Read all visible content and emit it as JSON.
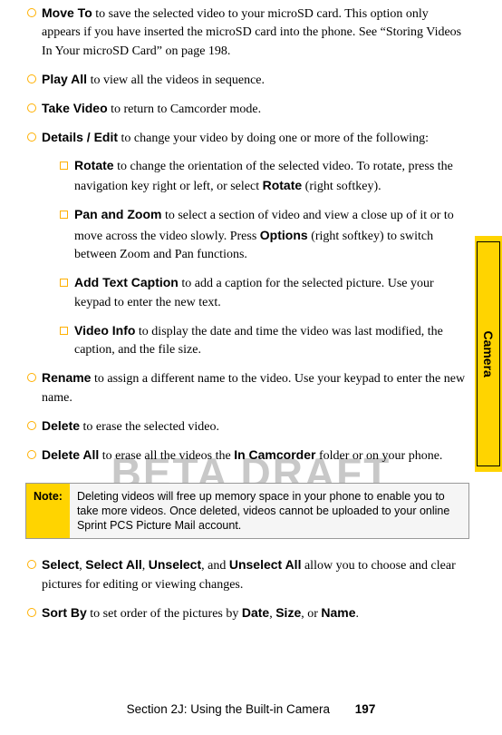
{
  "watermark": "BETA DRAFT",
  "sideTab": "Camera",
  "items": [
    {
      "bold": "Move To",
      "rest": " to save the selected video to your microSD card. This option only appears if you have inserted the microSD card into the phone. See “Storing Videos In Your microSD Card” on page 198."
    },
    {
      "bold": "Play All",
      "rest": " to view all the videos in sequence."
    },
    {
      "bold": "Take Video",
      "rest": " to return to Camcorder mode."
    },
    {
      "bold": "Details / Edit",
      "rest": " to change your video by doing one or more of the following:"
    }
  ],
  "sub": [
    {
      "bold": "Rotate",
      "rest": " to change the orientation of the selected video. To rotate, press the navigation key right or left, or select ",
      "bold2": "Rotate",
      "rest2": " (right softkey)."
    },
    {
      "bold": "Pan and Zoom",
      "rest": " to select a section of video and view a close up of it or to move across the video slowly. Press ",
      "bold2": "Options",
      "rest2": " (right softkey) to switch between Zoom and Pan functions."
    },
    {
      "bold": "Add Text Caption",
      "rest": " to add a caption for the selected picture. Use your keypad to enter the new text."
    },
    {
      "bold": "Video Info",
      "rest": " to display the date and time the video was last modified, the caption, and the file size."
    }
  ],
  "items2": [
    {
      "bold": "Rename",
      "rest": " to assign a different name to the video. Use your keypad to enter the new name."
    },
    {
      "bold": "Delete",
      "rest": " to erase the selected video."
    },
    {
      "bold": "Delete All",
      "rest": " to erase all the videos the ",
      "bold2": "In Camcorder",
      "rest2": " folder or on your phone."
    }
  ],
  "note": {
    "label": "Note:",
    "text": "Deleting videos will free up memory space in your phone to enable you to take more videos. Once deleted, videos cannot be uploaded to your online Sprint PCS Picture Mail account."
  },
  "items3a": {
    "pre": "",
    "b1": "Select",
    "s1": ", ",
    "b2": "Select All",
    "s2": ", ",
    "b3": "Unselect",
    "s3": ", and ",
    "b4": "Unselect All",
    "rest": " allow you to choose and clear pictures for editing or viewing changes."
  },
  "items3b": {
    "bold": "Sort By",
    "mid": " to set order of the pictures by ",
    "b1": "Date",
    "s1": ", ",
    "b2": "Size",
    "s2": ", or ",
    "b3": "Name",
    "end": "."
  },
  "footer": {
    "section": "Section 2J: Using the Built-in Camera",
    "page": "197"
  }
}
